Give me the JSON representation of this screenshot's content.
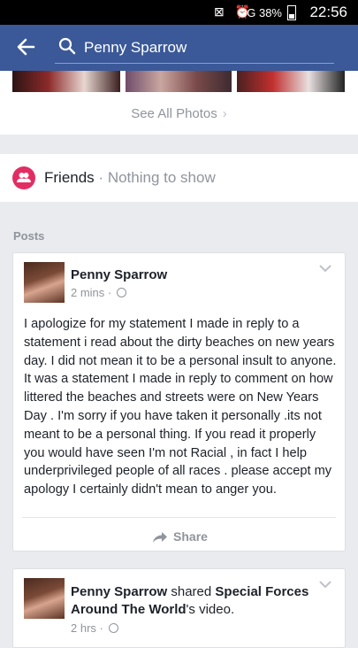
{
  "status_bar": {
    "battery": "38%",
    "time": "22:56",
    "network": "3G"
  },
  "search": {
    "query": "Penny Sparrow"
  },
  "photos": {
    "see_all_label": "See All Photos"
  },
  "friends": {
    "label": "Friends",
    "separator": "·",
    "subtext": "Nothing to show"
  },
  "posts_header": "Posts",
  "posts": [
    {
      "author": "Penny Sparrow",
      "time": "2 mins",
      "separator": "·",
      "body": "I apologize for my statement I made in reply to  a statement i read about the dirty beaches on new years day. I did not mean it to be a personal insult to anyone. It was a statement I made in reply to comment on how littered the beaches and streets were on New Years Day . I'm sorry if you have taken it personally .its not meant to be a personal thing. If you read it properly you would have seen I'm not Racial , in fact I help underprivileged people of all races . please accept my apology I certainly didn't mean to anger you.",
      "share_label": "Share"
    },
    {
      "author": "Penny Sparrow",
      "action": "shared",
      "target": "Special Forces Around The World",
      "suffix": "'s video.",
      "time": "2 hrs",
      "separator": "·"
    }
  ]
}
